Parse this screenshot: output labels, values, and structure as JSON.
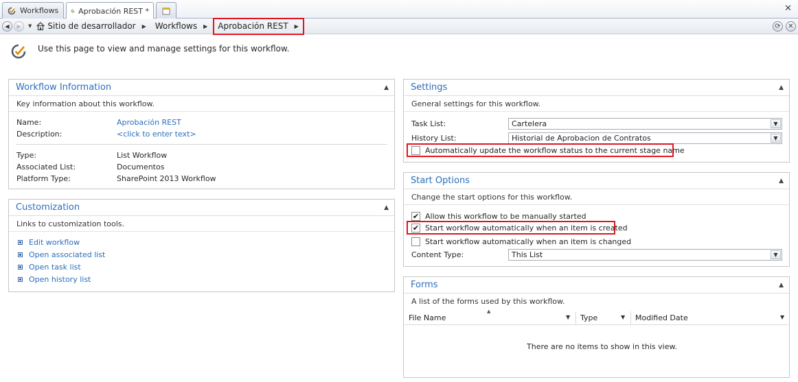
{
  "tabs": [
    {
      "label": "Workflows"
    },
    {
      "label": "Aprobación REST *"
    }
  ],
  "breadcrumb": {
    "items": [
      "Sitio de desarrollador",
      "Workflows"
    ],
    "current": "Aprobación REST"
  },
  "page": {
    "description": "Use this page to view and manage settings for this workflow."
  },
  "workflow_info": {
    "title": "Workflow Information",
    "desc": "Key information about this workflow.",
    "name_label": "Name:",
    "name_value": "Aprobación REST",
    "description_label": "Description:",
    "description_value": "<click to enter text>",
    "type_label": "Type:",
    "type_value": "List Workflow",
    "assoc_label": "Associated List:",
    "assoc_value": "Documentos",
    "platform_label": "Platform Type:",
    "platform_value": "SharePoint 2013 Workflow"
  },
  "customization": {
    "title": "Customization",
    "desc": "Links to customization tools.",
    "links": [
      "Edit workflow",
      "Open associated list",
      "Open task list",
      "Open history list"
    ]
  },
  "settings": {
    "title": "Settings",
    "desc": "General settings for this workflow.",
    "task_list_label": "Task List:",
    "task_list_value": "Cartelera",
    "history_list_label": "History List:",
    "history_list_value": "Historial de Aprobacion de Contratos",
    "auto_update_label": "Automatically update the workflow status to the current stage name",
    "auto_update_checked": false
  },
  "start_options": {
    "title": "Start Options",
    "desc": "Change the start options for this workflow.",
    "manual_label": "Allow this workflow to be manually started",
    "manual_checked": true,
    "on_create_label": "Start workflow automatically when an item is created",
    "on_create_checked": true,
    "on_change_label": "Start workflow automatically when an item is changed",
    "on_change_checked": false,
    "content_type_label": "Content Type:",
    "content_type_value": "This List"
  },
  "forms": {
    "title": "Forms",
    "desc": "A list of the forms used by this workflow.",
    "columns": [
      "File Name",
      "Type",
      "Modified Date"
    ],
    "empty_message": "There are no items to show in this view."
  },
  "colors": {
    "accent": "#2a6ebb",
    "highlight": "#e0141e"
  }
}
